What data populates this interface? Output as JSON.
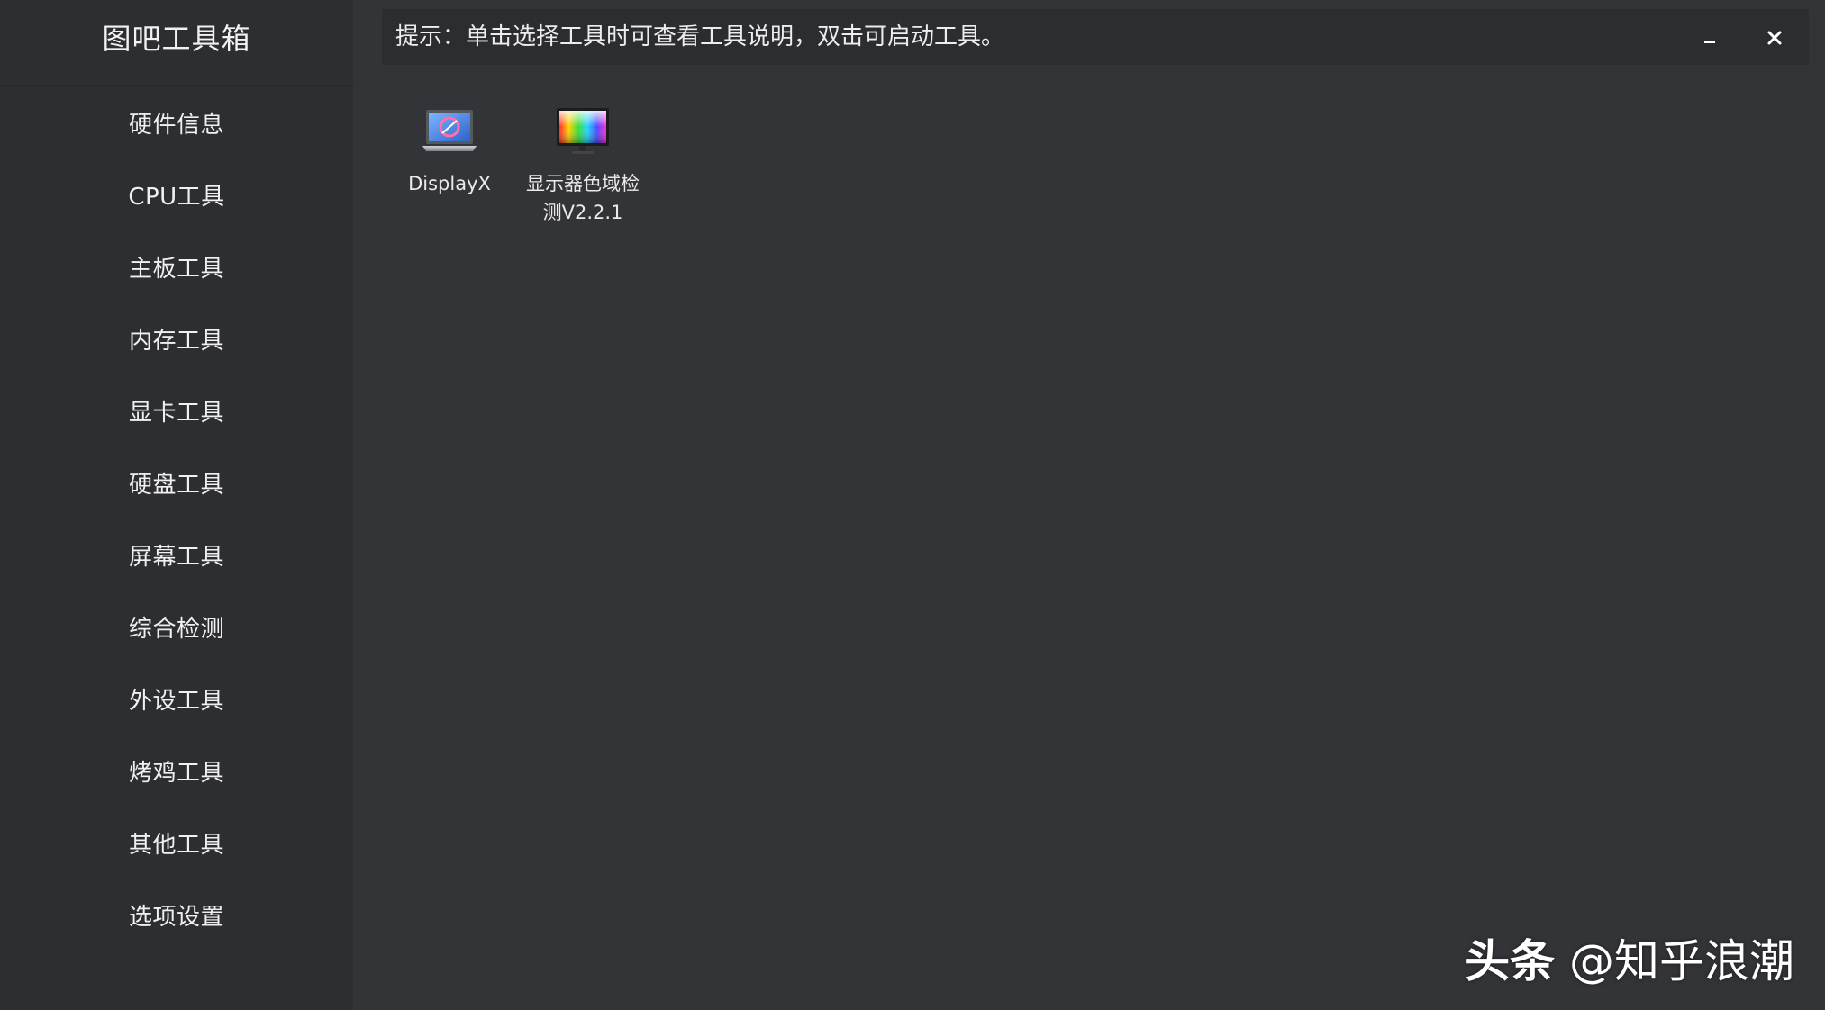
{
  "app": {
    "title": "图吧工具箱"
  },
  "sidebar": {
    "items": [
      {
        "label": "硬件信息"
      },
      {
        "label": "CPU工具"
      },
      {
        "label": "主板工具"
      },
      {
        "label": "内存工具"
      },
      {
        "label": "显卡工具"
      },
      {
        "label": "硬盘工具"
      },
      {
        "label": "屏幕工具"
      },
      {
        "label": "综合检测"
      },
      {
        "label": "外设工具"
      },
      {
        "label": "烤鸡工具"
      },
      {
        "label": "其他工具"
      },
      {
        "label": "选项设置"
      }
    ]
  },
  "hint": {
    "text": "提示：单击选择工具时可查看工具说明，双击可启动工具。"
  },
  "window_controls": {
    "minimize_icon": "minimize-icon",
    "close_icon": "close-icon",
    "close_glyph": "✕"
  },
  "tools": [
    {
      "label": "DisplayX",
      "icon": "laptop-icon"
    },
    {
      "label": "显示器色域检测V2.2.1",
      "icon": "color-monitor-icon"
    }
  ],
  "watermark": {
    "brand": "头条",
    "handle": "@知乎浪潮"
  },
  "colors": {
    "sidebar_bg": "#2d2e31",
    "main_bg": "#333438",
    "hint_bar_bg": "#2c2d30",
    "text": "#f0f0f0"
  }
}
